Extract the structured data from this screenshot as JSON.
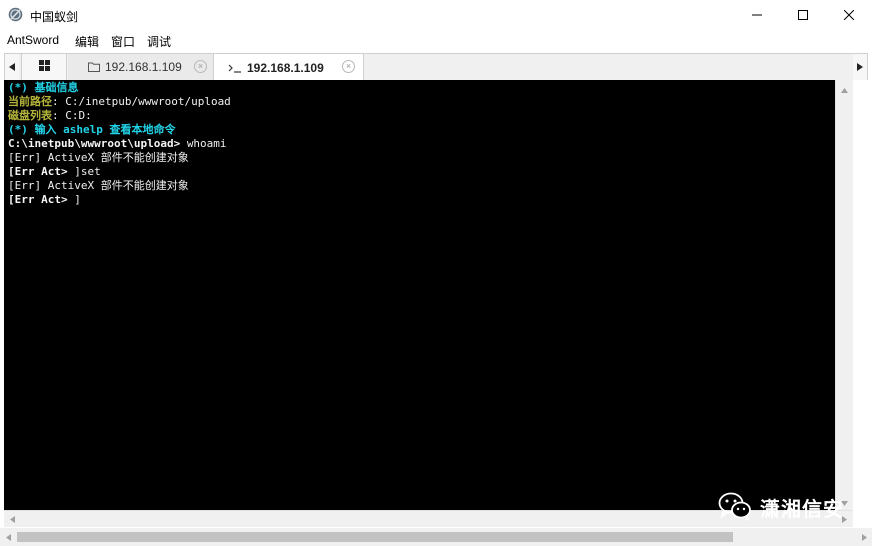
{
  "window": {
    "title": "中国蚁剑",
    "app_icon": "antsword-logo-icon",
    "controls": [
      "minimize-icon",
      "maximize-icon",
      "close-icon"
    ]
  },
  "menu": {
    "items": [
      "AntSword",
      "编辑",
      "窗口",
      "调试"
    ]
  },
  "tabs": {
    "home_icon": "grid-icon",
    "items": [
      {
        "label": "192.168.1.109",
        "icon": "folder-icon",
        "active": false
      },
      {
        "label": "192.168.1.109",
        "icon": "terminal-icon",
        "active": true
      }
    ],
    "close_glyph": "×"
  },
  "terminal": {
    "lines": [
      [
        {
          "text": "(*) 基础信息",
          "style": "cyan"
        }
      ],
      [
        {
          "text": "当前路径",
          "style": "olive"
        },
        {
          "text": ": C:/inetpub/wwwroot/upload",
          "style": "white"
        }
      ],
      [
        {
          "text": "磁盘列表",
          "style": "olive"
        },
        {
          "text": ": C:D:",
          "style": "white"
        }
      ],
      [
        {
          "text": "(*) 输入 ashelp 查看本地命令",
          "style": "cyan"
        }
      ],
      [
        {
          "text": "C:\\inetpub\\wwwroot\\upload> ",
          "style": "bold"
        },
        {
          "text": "whoami",
          "style": "white"
        }
      ],
      [
        {
          "text": "[Err] ActiveX 部件不能创建对象",
          "style": "white"
        }
      ],
      [
        {
          "text": "[Err Act> ",
          "style": "bold"
        },
        {
          "text": "]set",
          "style": "white"
        }
      ],
      [
        {
          "text": "[Err] ActiveX 部件不能创建对象",
          "style": "white"
        }
      ],
      [
        {
          "text": "[Err Act> ",
          "style": "bold"
        },
        {
          "text": "]",
          "style": "white"
        }
      ]
    ]
  },
  "watermark": {
    "text": "潇湘信安",
    "icon": "wechat-icon"
  },
  "colors": {
    "terminal_bg": "#000000",
    "cyan": "#22d3e8",
    "olive": "#b5b53c",
    "window_bg": "#ffffff",
    "scrollbar": "#f0f0f0"
  }
}
